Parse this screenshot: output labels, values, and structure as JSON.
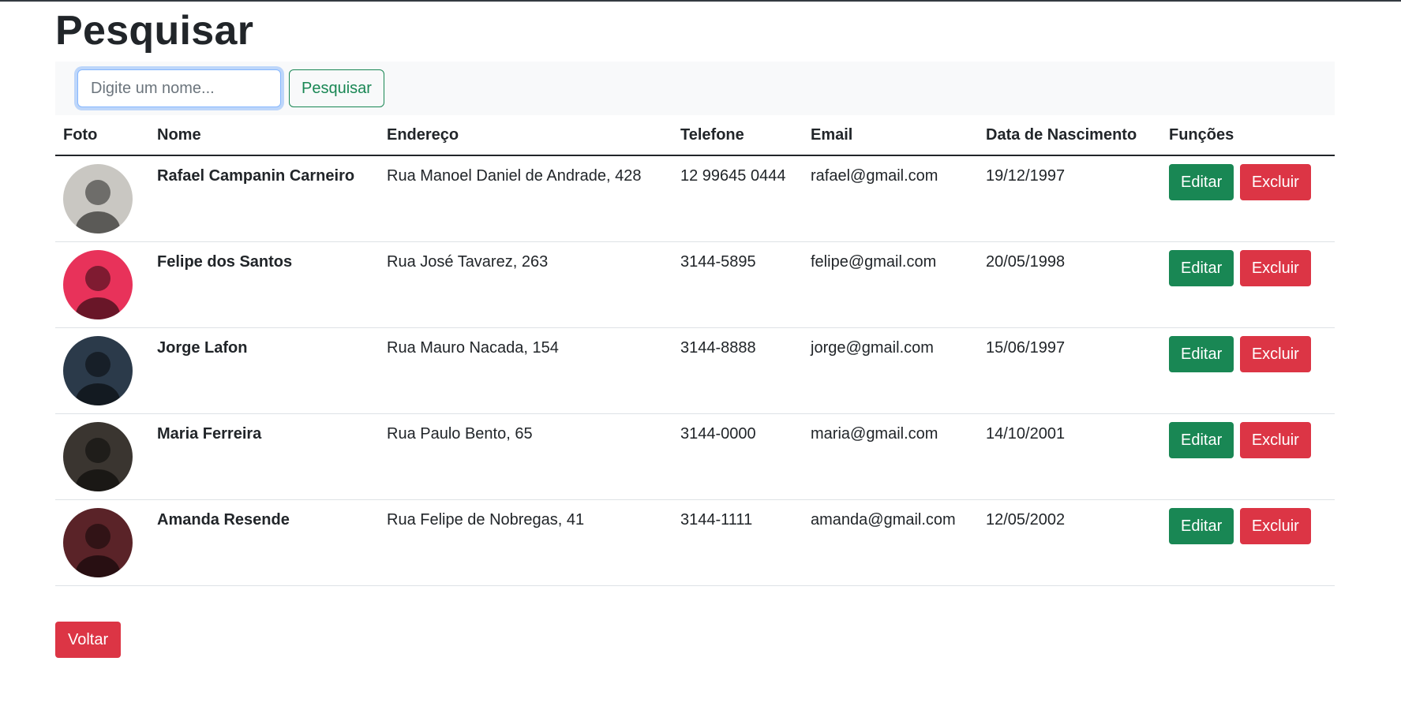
{
  "page": {
    "title": "Pesquisar"
  },
  "search": {
    "placeholder": "Digite um nome...",
    "value": "",
    "button_label": "Pesquisar"
  },
  "table": {
    "headers": [
      "Foto",
      "Nome",
      "Endereço",
      "Telefone",
      "Email",
      "Data de Nascimento",
      "Funções"
    ],
    "rows": [
      {
        "name": "Rafael Campanin Carneiro",
        "address": "Rua Manoel Daniel de Andrade, 428",
        "phone": "12 99645 0444",
        "email": "rafael@gmail.com",
        "birth": "19/12/1997",
        "edit": "Editar",
        "delete": "Excluir",
        "avatar_bg": "#c9c7c2"
      },
      {
        "name": "Felipe dos Santos",
        "address": "Rua José Tavarez, 263",
        "phone": "3144-5895",
        "email": "felipe@gmail.com",
        "birth": "20/05/1998",
        "edit": "Editar",
        "delete": "Excluir",
        "avatar_bg": "#e8325a"
      },
      {
        "name": "Jorge Lafon",
        "address": "Rua Mauro Nacada, 154",
        "phone": "3144-8888",
        "email": "jorge@gmail.com",
        "birth": "15/06/1997",
        "edit": "Editar",
        "delete": "Excluir",
        "avatar_bg": "#2b3a4a"
      },
      {
        "name": "Maria Ferreira",
        "address": "Rua Paulo Bento, 65",
        "phone": "3144-0000",
        "email": "maria@gmail.com",
        "birth": "14/10/2001",
        "edit": "Editar",
        "delete": "Excluir",
        "avatar_bg": "#3a3530"
      },
      {
        "name": "Amanda Resende",
        "address": "Rua Felipe de Nobregas, 41",
        "phone": "3144-1111",
        "email": "amanda@gmail.com",
        "birth": "12/05/2002",
        "edit": "Editar",
        "delete": "Excluir",
        "avatar_bg": "#5a2328"
      }
    ]
  },
  "footer": {
    "back_label": "Voltar"
  },
  "colors": {
    "success": "#198754",
    "danger": "#dc3545",
    "focus": "#86b7fe"
  }
}
